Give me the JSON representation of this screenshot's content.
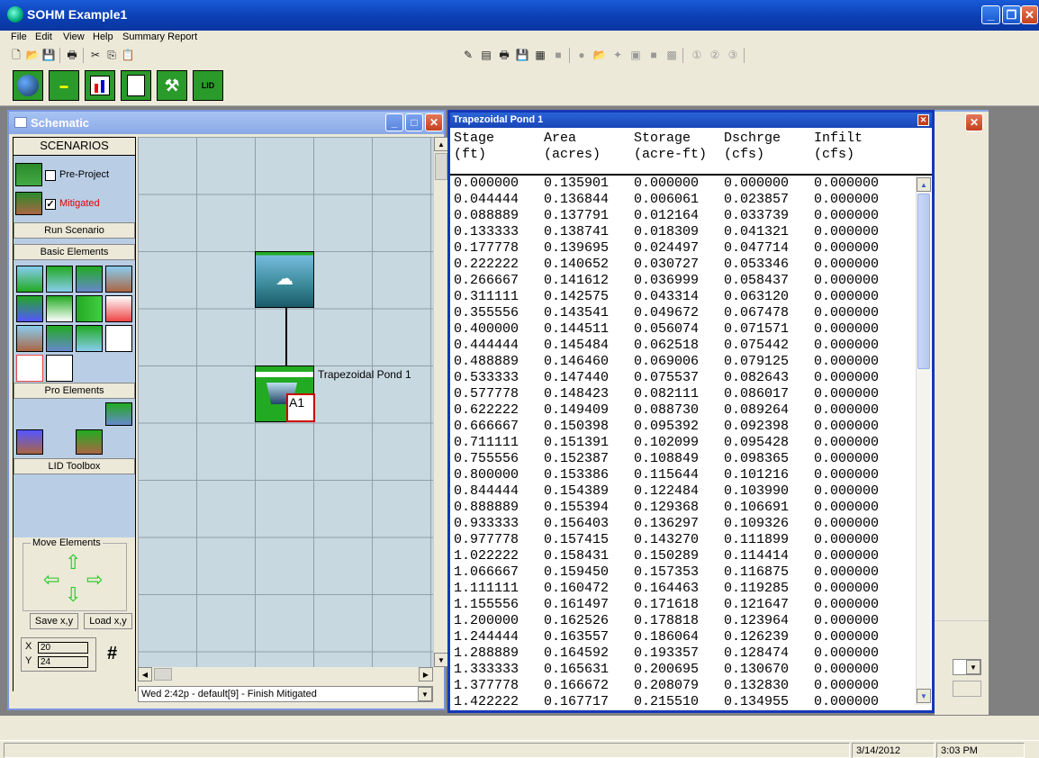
{
  "app": {
    "title": "SOHM  Example1"
  },
  "menu": [
    "File",
    "Edit",
    "View",
    "Help",
    "Summary Report"
  ],
  "schematic": {
    "title": "Schematic",
    "scenarios_header": "SCENARIOS",
    "pre_project": "Pre-Project",
    "mitigated": "Mitigated",
    "mitigated_checked": "☑",
    "run_scenario": "Run Scenario",
    "basic_elements": "Basic Elements",
    "pro_elements": "Pro Elements",
    "lid_toolbox": "LID Toolbox",
    "move_elements": "Move Elements",
    "save_xy": "Save x,y",
    "load_xy": "Load x,y",
    "x_label": "X",
    "y_label": "Y",
    "x_value": "20",
    "y_value": "24",
    "pond_label": "Trapezoidal Pond  1",
    "pond_badge": "A1",
    "status_text": "Wed 2:42p - default[9] - Finish Mitigated",
    "grid_symbol": "#"
  },
  "pond_window": {
    "title": "Trapezoidal Pond  1",
    "headers": [
      [
        "Stage",
        "(ft)"
      ],
      [
        "Area",
        "(acres)"
      ],
      [
        "Storage",
        "(acre-ft)"
      ],
      [
        "Dschrge",
        "(cfs)"
      ],
      [
        "Infilt",
        "(cfs)"
      ]
    ],
    "rows": [
      [
        "0.000000",
        "0.135901",
        "0.000000",
        "0.000000",
        "0.000000"
      ],
      [
        "0.044444",
        "0.136844",
        "0.006061",
        "0.023857",
        "0.000000"
      ],
      [
        "0.088889",
        "0.137791",
        "0.012164",
        "0.033739",
        "0.000000"
      ],
      [
        "0.133333",
        "0.138741",
        "0.018309",
        "0.041321",
        "0.000000"
      ],
      [
        "0.177778",
        "0.139695",
        "0.024497",
        "0.047714",
        "0.000000"
      ],
      [
        "0.222222",
        "0.140652",
        "0.030727",
        "0.053346",
        "0.000000"
      ],
      [
        "0.266667",
        "0.141612",
        "0.036999",
        "0.058437",
        "0.000000"
      ],
      [
        "0.311111",
        "0.142575",
        "0.043314",
        "0.063120",
        "0.000000"
      ],
      [
        "0.355556",
        "0.143541",
        "0.049672",
        "0.067478",
        "0.000000"
      ],
      [
        "0.400000",
        "0.144511",
        "0.056074",
        "0.071571",
        "0.000000"
      ],
      [
        "0.444444",
        "0.145484",
        "0.062518",
        "0.075442",
        "0.000000"
      ],
      [
        "0.488889",
        "0.146460",
        "0.069006",
        "0.079125",
        "0.000000"
      ],
      [
        "0.533333",
        "0.147440",
        "0.075537",
        "0.082643",
        "0.000000"
      ],
      [
        "0.577778",
        "0.148423",
        "0.082111",
        "0.086017",
        "0.000000"
      ],
      [
        "0.622222",
        "0.149409",
        "0.088730",
        "0.089264",
        "0.000000"
      ],
      [
        "0.666667",
        "0.150398",
        "0.095392",
        "0.092398",
        "0.000000"
      ],
      [
        "0.711111",
        "0.151391",
        "0.102099",
        "0.095428",
        "0.000000"
      ],
      [
        "0.755556",
        "0.152387",
        "0.108849",
        "0.098365",
        "0.000000"
      ],
      [
        "0.800000",
        "0.153386",
        "0.115644",
        "0.101216",
        "0.000000"
      ],
      [
        "0.844444",
        "0.154389",
        "0.122484",
        "0.103990",
        "0.000000"
      ],
      [
        "0.888889",
        "0.155394",
        "0.129368",
        "0.106691",
        "0.000000"
      ],
      [
        "0.933333",
        "0.156403",
        "0.136297",
        "0.109326",
        "0.000000"
      ],
      [
        "0.977778",
        "0.157415",
        "0.143270",
        "0.111899",
        "0.000000"
      ],
      [
        "1.022222",
        "0.158431",
        "0.150289",
        "0.114414",
        "0.000000"
      ],
      [
        "1.066667",
        "0.159450",
        "0.157353",
        "0.116875",
        "0.000000"
      ],
      [
        "1.111111",
        "0.160472",
        "0.164463",
        "0.119285",
        "0.000000"
      ],
      [
        "1.155556",
        "0.161497",
        "0.171618",
        "0.121647",
        "0.000000"
      ],
      [
        "1.200000",
        "0.162526",
        "0.178818",
        "0.123964",
        "0.000000"
      ],
      [
        "1.244444",
        "0.163557",
        "0.186064",
        "0.126239",
        "0.000000"
      ],
      [
        "1.288889",
        "0.164592",
        "0.193357",
        "0.128474",
        "0.000000"
      ],
      [
        "1.333333",
        "0.165631",
        "0.200695",
        "0.130670",
        "0.000000"
      ],
      [
        "1.377778",
        "0.166672",
        "0.208079",
        "0.132830",
        "0.000000"
      ],
      [
        "1.422222",
        "0.167717",
        "0.215510",
        "0.134955",
        "0.000000"
      ]
    ]
  },
  "statusbar": {
    "date": "3/14/2012",
    "time": "3:03 PM"
  },
  "colors": {
    "titlebar": "#0b3fb4",
    "mitigated_text": "#e00000",
    "canvas": "#c8d8e0",
    "panel": "#b9cde5"
  }
}
